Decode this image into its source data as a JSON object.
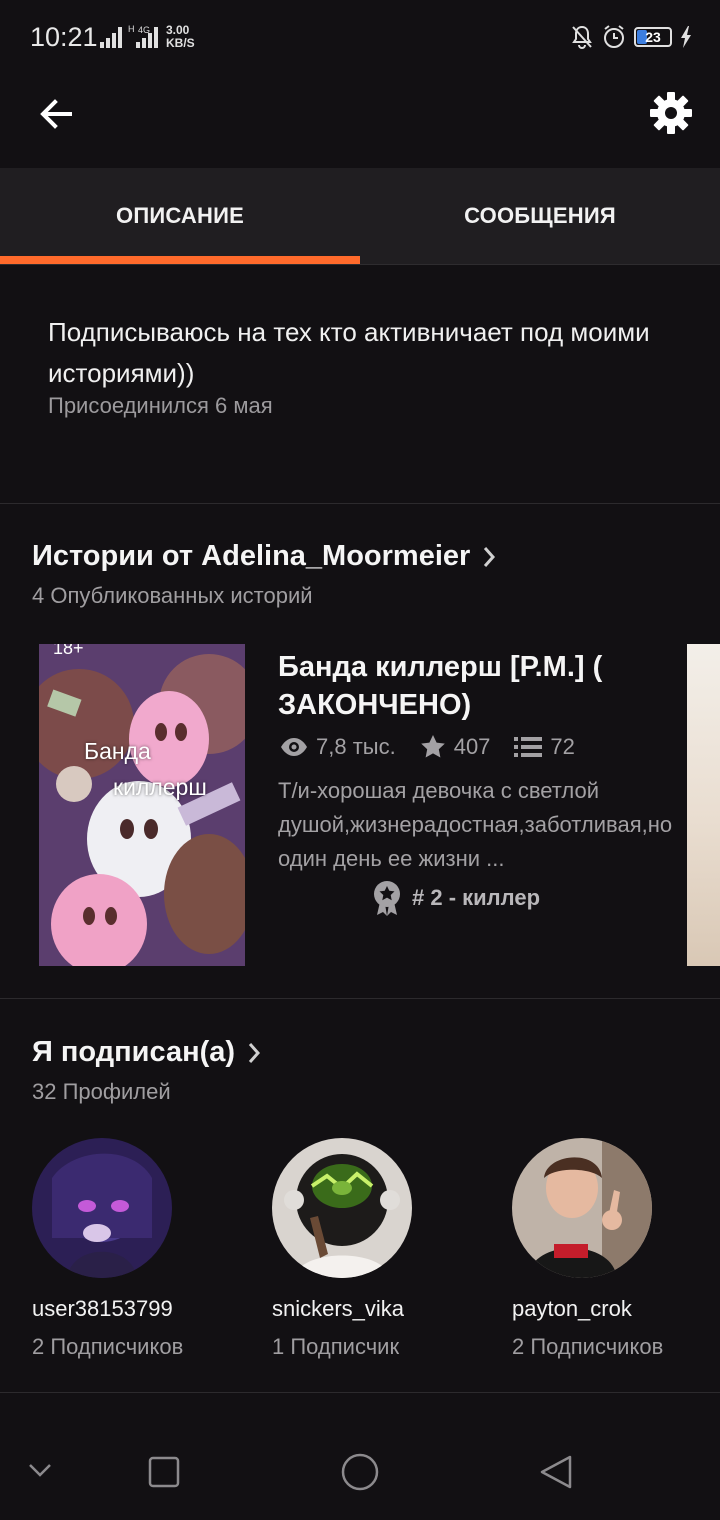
{
  "status_bar": {
    "time": "10:21",
    "network_type": "4G",
    "speed_value": "3.00",
    "speed_unit": "KB/S",
    "battery_level": "23",
    "icons": [
      "signal-icon",
      "signal-4g-icon",
      "mute-icon",
      "alarm-icon",
      "battery-icon",
      "charging-icon"
    ]
  },
  "app_bar": {
    "back_icon": "arrow-left-icon",
    "settings_icon": "gear-icon"
  },
  "tabs": [
    {
      "label": "ОПИСАНИЕ",
      "active": true
    },
    {
      "label": "СООБЩЕНИЯ",
      "active": false
    }
  ],
  "accent_color": "#ff6a2b",
  "profile": {
    "description": "Подписываюсь на тех кто активничает под моими историями))",
    "joined": "Присоединился 6 мая"
  },
  "stories_section": {
    "title": "Истории от Adelina_Moormeier",
    "subtitle": "4 Опубликованных историй",
    "stories": [
      {
        "cover_age": "18+",
        "cover_line1": "Банда",
        "cover_line2": "киллерш",
        "title": "Банда киллерш [Р.М.] ( ЗАКОНЧЕНО)",
        "views": "7,8 тыс.",
        "votes": "407",
        "parts": "72",
        "description": "Т/и-хорошая девочка с светлой душой,жизнерадостная,заботливая,но один день ее жизни ...",
        "rank": "# 2 - киллер"
      }
    ]
  },
  "following_section": {
    "title": "Я подписан(а)",
    "subtitle": "32 Профилей",
    "profiles": [
      {
        "name": "user38153799",
        "followers": "2 Подписчиков"
      },
      {
        "name": "snickers_vika",
        "followers": "1 Подписчик"
      },
      {
        "name": "payton_crok",
        "followers": "2 Подписчиков"
      }
    ]
  },
  "nav_bar": {
    "icons": [
      "chevron-down-icon",
      "recents-square-icon",
      "home-circle-icon",
      "back-triangle-icon"
    ]
  }
}
